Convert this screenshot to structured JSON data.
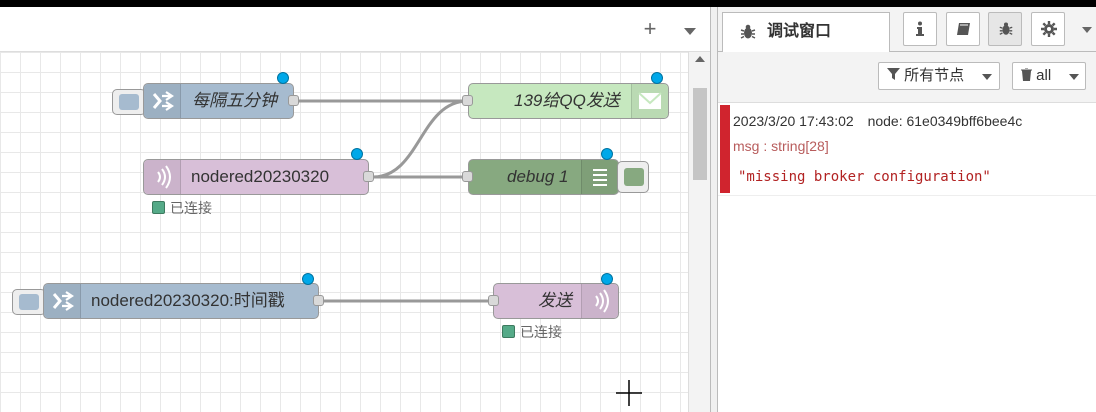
{
  "workspace": {
    "toolbar": {
      "add_icon": "plus-icon",
      "menu_icon": "chevron-down-icon"
    },
    "nodes": [
      {
        "id": "inject1",
        "label": "每隔五分钟",
        "type": "inject",
        "color": "#a6bbcf",
        "icon": "arrow-right-icon"
      },
      {
        "id": "mqttin",
        "label": "nodered20230320",
        "type": "mqtt-in",
        "color": "#d8bfd8",
        "icon": "signal-icon",
        "status": "已连接"
      },
      {
        "id": "email",
        "label": "139给QQ发送",
        "type": "email",
        "color": "#c0deed",
        "icon": "envelope-icon"
      },
      {
        "id": "debug1",
        "label": "debug 1",
        "type": "debug",
        "color": "#87a980",
        "icon": "list-icon"
      },
      {
        "id": "inject2",
        "label": "nodered20230320:时间戳",
        "type": "inject",
        "color": "#a6bbcf",
        "icon": "arrow-right-icon"
      },
      {
        "id": "mqttout",
        "label": "发送",
        "type": "mqtt-out",
        "color": "#d8bfd8",
        "icon": "signal-icon",
        "status": "已连接"
      }
    ]
  },
  "sidebar": {
    "tab_title": "调试窗口",
    "buttons": [
      "info-icon",
      "book-icon",
      "bug-icon",
      "gear-icon"
    ],
    "filter_nodes": "所有节点",
    "filter_clear": "all",
    "message": {
      "timestamp": "2023/3/20 17:43:02",
      "node": "node: 61e0349bff6bee4c",
      "topic": "msg : string[28]",
      "payload": "\"missing broker configuration\""
    }
  }
}
